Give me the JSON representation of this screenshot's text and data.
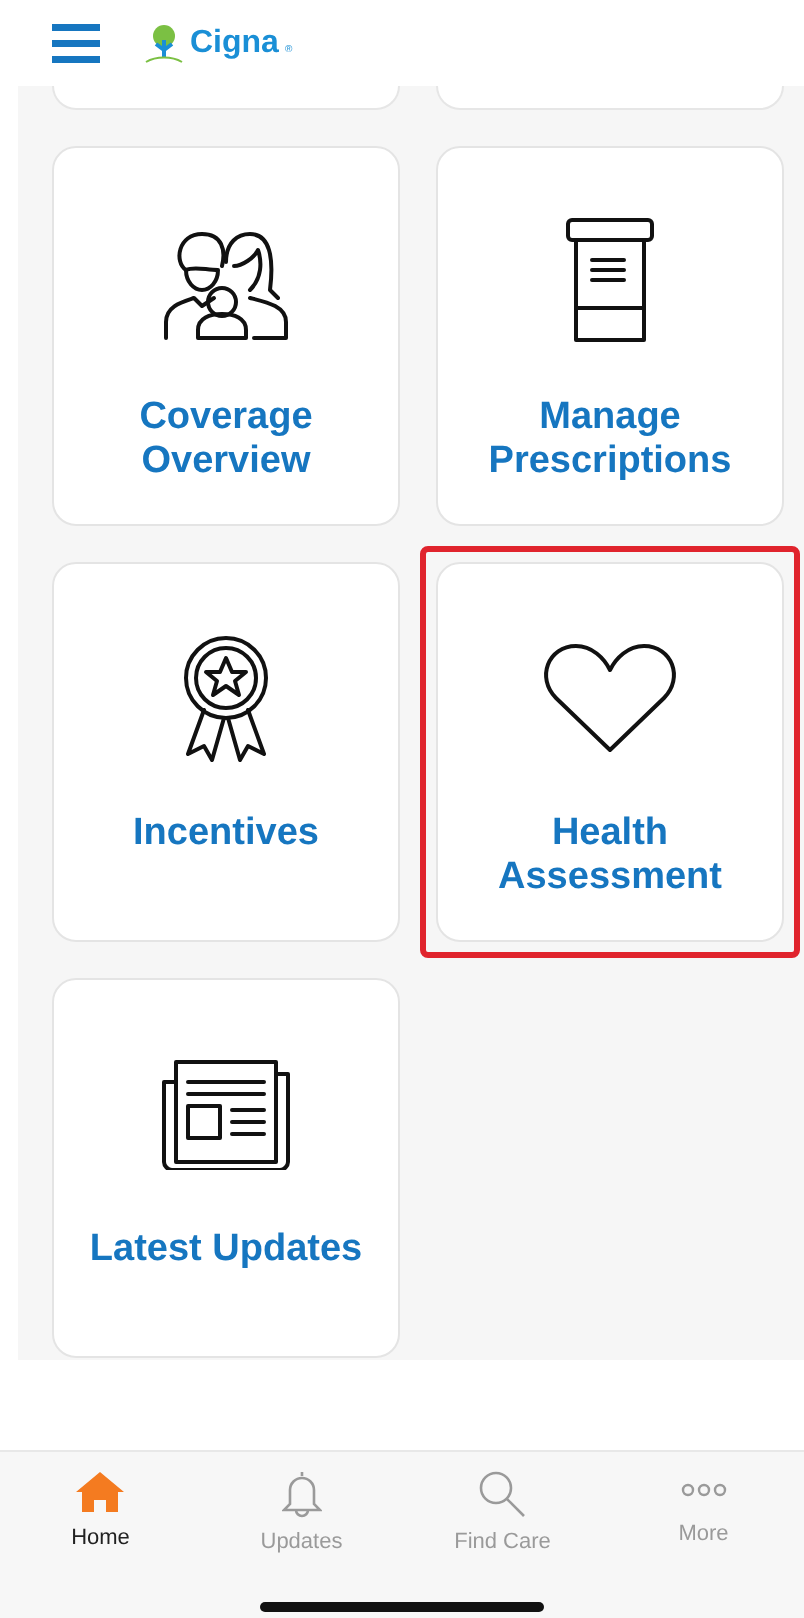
{
  "header": {
    "logo_text": "Cigna",
    "logo_mark": "®"
  },
  "tiles": [
    {
      "kind": "family",
      "label": "Coverage Overview",
      "highlighted": false
    },
    {
      "kind": "bottle",
      "label": "Manage Prescriptions",
      "highlighted": false
    },
    {
      "kind": "ribbon",
      "label": "Incentives",
      "highlighted": false
    },
    {
      "kind": "heart",
      "label": "Health Assessment",
      "highlighted": true
    },
    {
      "kind": "news",
      "label": "Latest Updates",
      "highlighted": false
    }
  ],
  "tab_bar": [
    {
      "kind": "home",
      "label": "Home",
      "selected": true
    },
    {
      "kind": "bell",
      "label": "Updates",
      "selected": false
    },
    {
      "kind": "search",
      "label": "Find Care",
      "selected": false
    },
    {
      "kind": "more",
      "label": "More",
      "selected": false
    }
  ]
}
